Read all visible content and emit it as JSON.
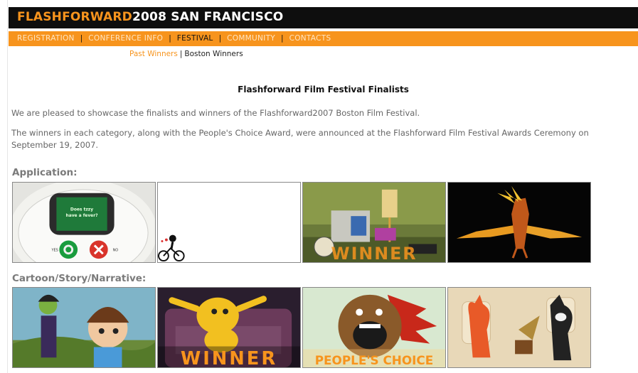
{
  "header": {
    "brand_part1": "FLASHFORWARD",
    "brand_part2": "2008 SAN FRANCISCO"
  },
  "nav": {
    "items": [
      {
        "label": "REGISTRATION"
      },
      {
        "label": "CONFERENCE INFO"
      },
      {
        "label": "FESTIVAL"
      },
      {
        "label": "COMMUNITY"
      },
      {
        "label": "CONTACTS"
      }
    ],
    "separator": "|",
    "active": "FESTIVAL"
  },
  "subnav": {
    "items": [
      {
        "label": "Past Winners"
      },
      {
        "label": "Boston Winners"
      }
    ],
    "separator": "|"
  },
  "main": {
    "title": "Flashforward Film Festival Finalists",
    "paragraph1": "We are pleased to showcase the finalists and winners of the Flashforward2007 Boston Film Festival.",
    "paragraph2": "The winners in each category, along with the People's Choice Award, were announced at the Flashforward Film Festival Awards Ceremony on September 19, 2007.",
    "sections": [
      {
        "title": "Application:",
        "thumbs": [
          {
            "text_lines": [
              "Does tzzy",
              "have a fever?"
            ],
            "yes": "YES",
            "no": "NO"
          },
          {},
          {
            "overlay": "WINNER"
          },
          {}
        ]
      },
      {
        "title": "Cartoon/Story/Narrative:",
        "thumbs": [
          {},
          {
            "overlay": "WINNER"
          },
          {
            "overlay": "PEOPLE'S CHOICE"
          },
          {}
        ]
      }
    ]
  },
  "colors": {
    "brand_orange": "#f7941d",
    "header_black": "#0e0e0e",
    "text_grey": "#666666"
  }
}
